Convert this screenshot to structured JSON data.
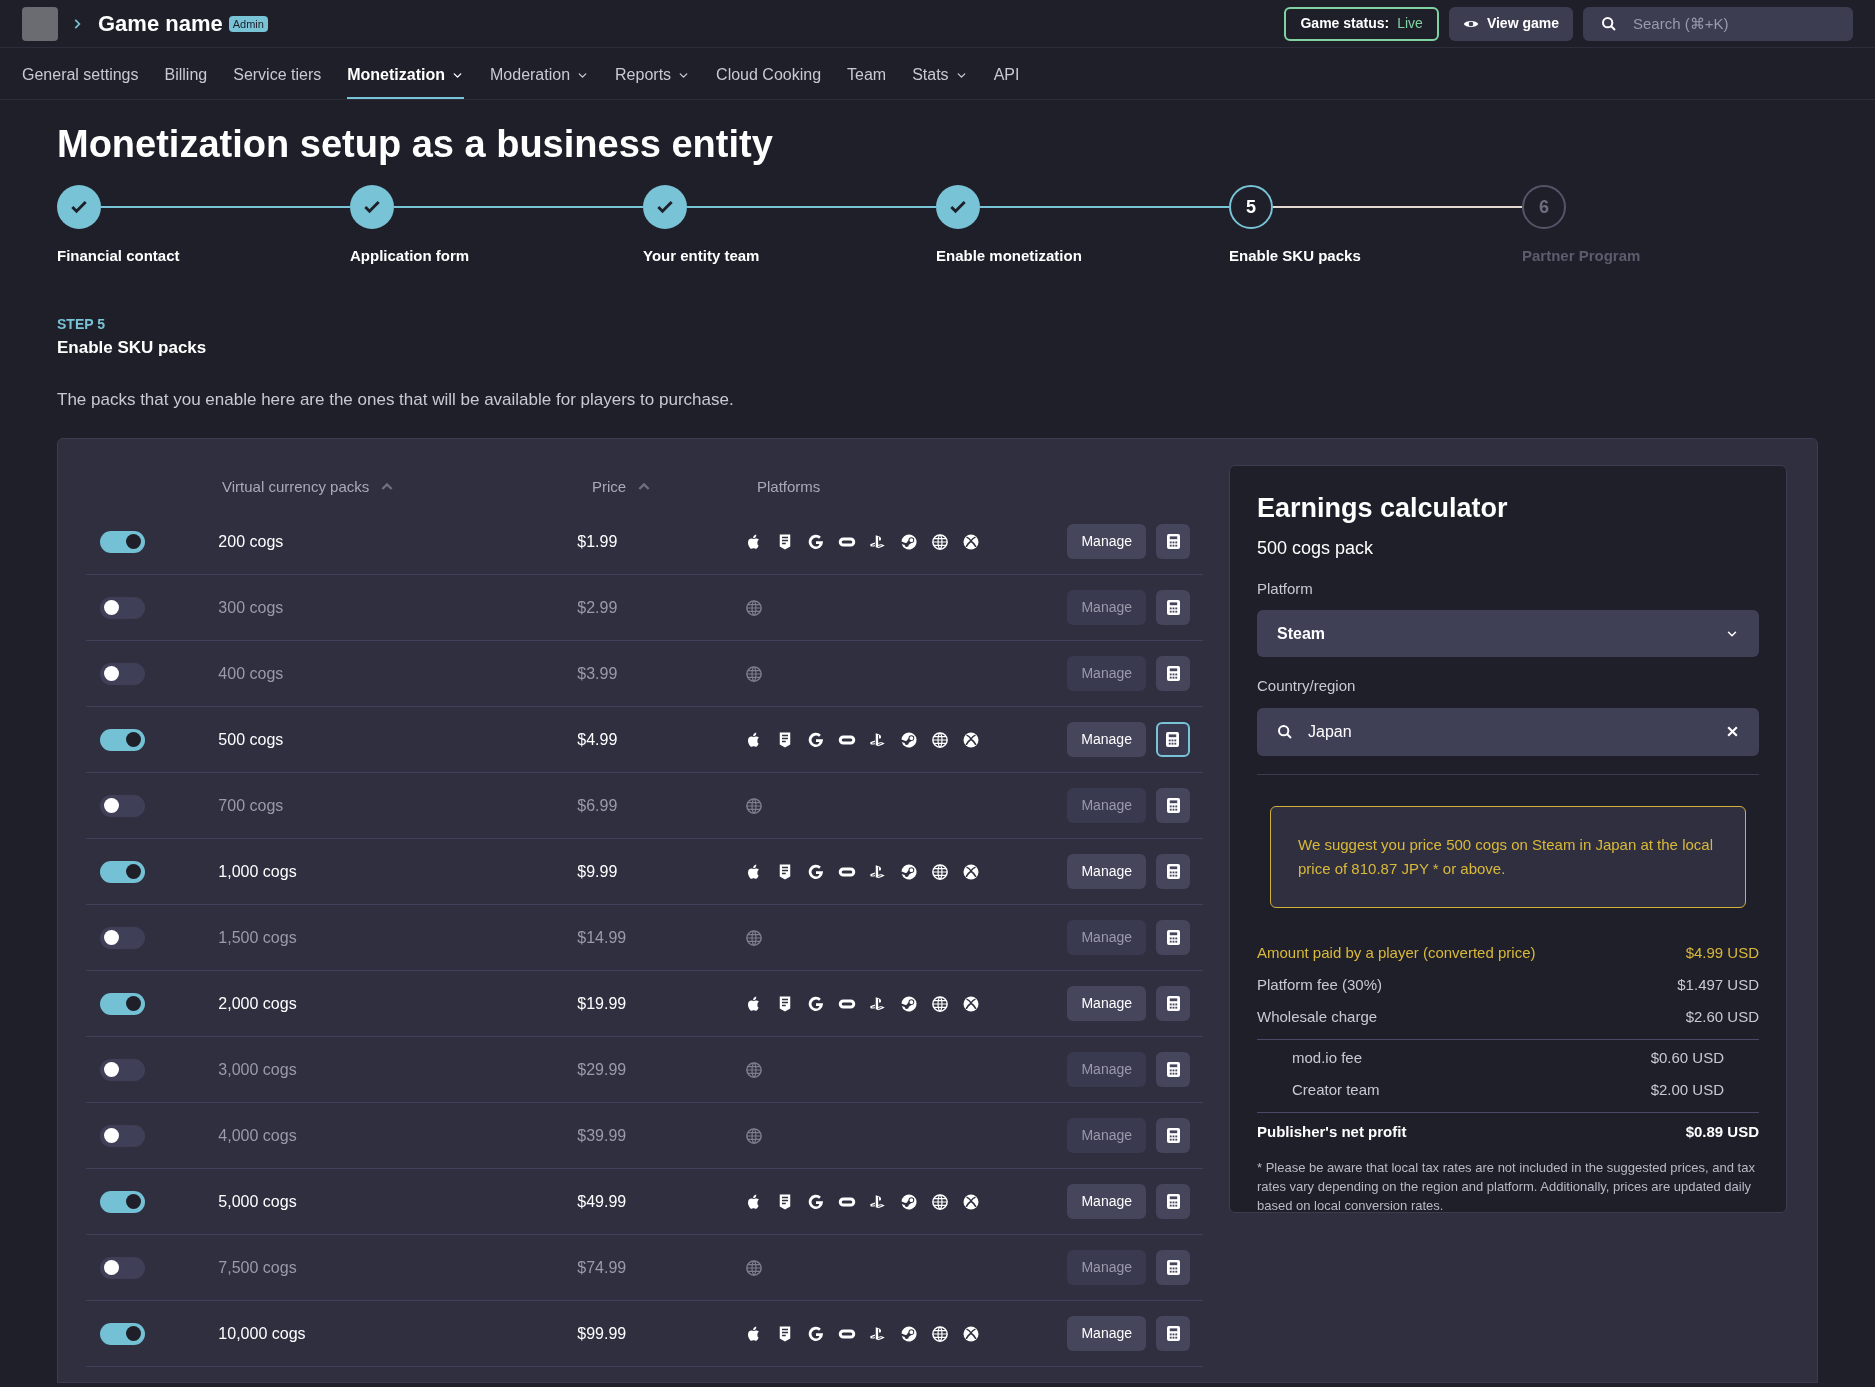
{
  "header": {
    "game_name": "Game name",
    "badge": "Admin",
    "status_label": "Game status:",
    "status_value": "Live",
    "view_button": "View game",
    "search": {
      "placeholder": "Search (⌘+K)"
    }
  },
  "nav": [
    {
      "label": "General settings",
      "selected": false,
      "has_menu": false
    },
    {
      "label": "Billing",
      "selected": false,
      "has_menu": false
    },
    {
      "label": "Service tiers",
      "selected": false,
      "has_menu": false
    },
    {
      "label": "Monetization",
      "selected": true,
      "has_menu": true
    },
    {
      "label": "Moderation",
      "selected": false,
      "has_menu": true
    },
    {
      "label": "Reports",
      "selected": false,
      "has_menu": true
    },
    {
      "label": "Cloud Cooking",
      "selected": false,
      "has_menu": false
    },
    {
      "label": "Team",
      "selected": false,
      "has_menu": false
    },
    {
      "label": "Stats",
      "selected": false,
      "has_menu": true
    },
    {
      "label": "API",
      "selected": false,
      "has_menu": false
    }
  ],
  "title": "Monetization setup as a business entity",
  "steps": [
    {
      "label": "Financial contact",
      "kind": "done"
    },
    {
      "label": "Application form",
      "kind": "done"
    },
    {
      "label": "Your entity team",
      "kind": "done"
    },
    {
      "label": "Enable monetization",
      "kind": "done"
    },
    {
      "label": "Enable SKU packs",
      "kind": "current",
      "number": "5"
    },
    {
      "label": "Partner Program",
      "kind": "upcoming",
      "number": "6"
    }
  ],
  "section": {
    "eyebrow": "STEP 5",
    "heading": "Enable SKU packs",
    "description": "The packs that you enable here are the ones that will be available for players to purchase."
  },
  "table": {
    "columns": [
      {
        "label": "Virtual currency packs",
        "sortable": true
      },
      {
        "label": "Price",
        "sortable": true
      },
      {
        "label": "Platforms",
        "sortable": false
      }
    ],
    "rows": [
      {
        "name": "200 cogs",
        "price": "$1.99",
        "enabled": true,
        "selected": false,
        "platforms": [
          {
            "kind": "apple"
          },
          {
            "kind": "epic"
          },
          {
            "kind": "google"
          },
          {
            "kind": "oculus"
          },
          {
            "kind": "playstation"
          },
          {
            "kind": "steam"
          },
          {
            "kind": "web"
          },
          {
            "kind": "xbox"
          }
        ],
        "button": "Manage"
      },
      {
        "name": "300 cogs",
        "price": "$2.99",
        "enabled": false,
        "selected": false,
        "platforms": [
          {
            "kind": "web"
          }
        ],
        "button": "Manage"
      },
      {
        "name": "400 cogs",
        "price": "$3.99",
        "enabled": false,
        "selected": false,
        "platforms": [
          {
            "kind": "web"
          }
        ],
        "button": "Manage"
      },
      {
        "name": "500 cogs",
        "price": "$4.99",
        "enabled": true,
        "selected": true,
        "platforms": [
          {
            "kind": "apple"
          },
          {
            "kind": "epic"
          },
          {
            "kind": "google"
          },
          {
            "kind": "oculus"
          },
          {
            "kind": "playstation"
          },
          {
            "kind": "steam"
          },
          {
            "kind": "web"
          },
          {
            "kind": "xbox"
          }
        ],
        "button": "Manage"
      },
      {
        "name": "700 cogs",
        "price": "$6.99",
        "enabled": false,
        "selected": false,
        "platforms": [
          {
            "kind": "web"
          }
        ],
        "button": "Manage"
      },
      {
        "name": "1,000 cogs",
        "price": "$9.99",
        "enabled": true,
        "selected": false,
        "platforms": [
          {
            "kind": "apple"
          },
          {
            "kind": "epic"
          },
          {
            "kind": "google"
          },
          {
            "kind": "oculus"
          },
          {
            "kind": "playstation"
          },
          {
            "kind": "steam"
          },
          {
            "kind": "web"
          },
          {
            "kind": "xbox"
          }
        ],
        "button": "Manage"
      },
      {
        "name": "1,500 cogs",
        "price": "$14.99",
        "enabled": false,
        "selected": false,
        "platforms": [
          {
            "kind": "web"
          }
        ],
        "button": "Manage"
      },
      {
        "name": "2,000 cogs",
        "price": "$19.99",
        "enabled": true,
        "selected": false,
        "platforms": [
          {
            "kind": "apple"
          },
          {
            "kind": "epic"
          },
          {
            "kind": "google"
          },
          {
            "kind": "oculus"
          },
          {
            "kind": "playstation"
          },
          {
            "kind": "steam"
          },
          {
            "kind": "web"
          },
          {
            "kind": "xbox"
          }
        ],
        "button": "Manage"
      },
      {
        "name": "3,000 cogs",
        "price": "$29.99",
        "enabled": false,
        "selected": false,
        "platforms": [
          {
            "kind": "web"
          }
        ],
        "button": "Manage"
      },
      {
        "name": "4,000 cogs",
        "price": "$39.99",
        "enabled": false,
        "selected": false,
        "platforms": [
          {
            "kind": "web"
          }
        ],
        "button": "Manage"
      },
      {
        "name": "5,000 cogs",
        "price": "$49.99",
        "enabled": true,
        "selected": false,
        "platforms": [
          {
            "kind": "apple"
          },
          {
            "kind": "epic"
          },
          {
            "kind": "google"
          },
          {
            "kind": "oculus"
          },
          {
            "kind": "playstation"
          },
          {
            "kind": "steam"
          },
          {
            "kind": "web"
          },
          {
            "kind": "xbox"
          }
        ],
        "button": "Manage"
      },
      {
        "name": "7,500 cogs",
        "price": "$74.99",
        "enabled": false,
        "selected": false,
        "platforms": [
          {
            "kind": "web"
          }
        ],
        "button": "Manage"
      },
      {
        "name": "10,000 cogs",
        "price": "$99.99",
        "enabled": true,
        "selected": false,
        "platforms": [
          {
            "kind": "apple"
          },
          {
            "kind": "epic"
          },
          {
            "kind": "google"
          },
          {
            "kind": "oculus"
          },
          {
            "kind": "playstation"
          },
          {
            "kind": "steam"
          },
          {
            "kind": "web"
          },
          {
            "kind": "xbox"
          }
        ],
        "button": "Manage"
      }
    ]
  },
  "calculator": {
    "title": "Earnings calculator",
    "subtitle": "500 cogs pack",
    "platform_label": "Platform",
    "platform_value": "Steam",
    "region_label": "Country/region",
    "region_value": "Japan",
    "suggestion": "We suggest you price 500 cogs on Steam in Japan at the local price of 810.87 JPY * or above.",
    "lines": [
      {
        "label": "Amount paid by a player (converted price)",
        "value": "$4.99 USD",
        "kind": "highlight"
      },
      {
        "label": "Platform fee (30%)",
        "value": "$1.497 USD",
        "kind": "normal"
      },
      {
        "label": "Wholesale charge",
        "value": "$2.60 USD",
        "kind": "normal",
        "children": [
          {
            "label": "mod.io fee",
            "value": "$0.60 USD"
          },
          {
            "label": "Creator team",
            "value": "$2.00 USD"
          }
        ]
      },
      {
        "label": "Publisher's net profit",
        "value": "$0.89 USD",
        "kind": "total"
      }
    ],
    "footnote": "* Please be aware that local tax rates are not included in the suggested prices, and tax rates vary depending on the region and platform. Additionally, prices are updated daily based on local conversion rates."
  }
}
